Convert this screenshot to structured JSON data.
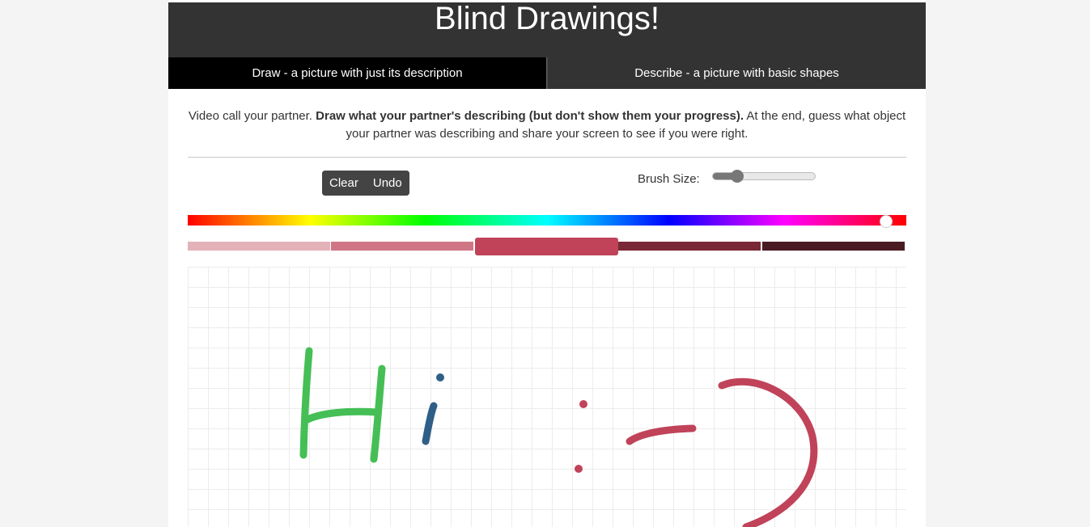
{
  "header": {
    "title": "Blind Drawings!"
  },
  "tabs": [
    {
      "label": "Draw - a picture with just its description",
      "active": true
    },
    {
      "label": "Describe - a picture with basic shapes",
      "active": false
    }
  ],
  "instructions": {
    "prefix": "Video call your partner. ",
    "bold": "Draw what your partner's describing (but don't show them your progress).",
    "suffix": " At the end, guess what object your partner was describing and share your screen to see if you were right."
  },
  "toolbar": {
    "clear_label": "Clear",
    "undo_label": "Undo",
    "brush_label": "Brush Size:"
  },
  "brush_size": {
    "value_fraction": 0.24
  },
  "colors": {
    "header_bg": "#333333",
    "active_tab_bg": "#000000",
    "shades": [
      "#e3b2b9",
      "#cf7584",
      "#c0435a",
      "#7a2836",
      "#4a1a22"
    ],
    "selected_shade_index": 2,
    "stroke_green": "#45bf55",
    "stroke_blue": "#2f5f87",
    "stroke_red": "#c0435a"
  }
}
